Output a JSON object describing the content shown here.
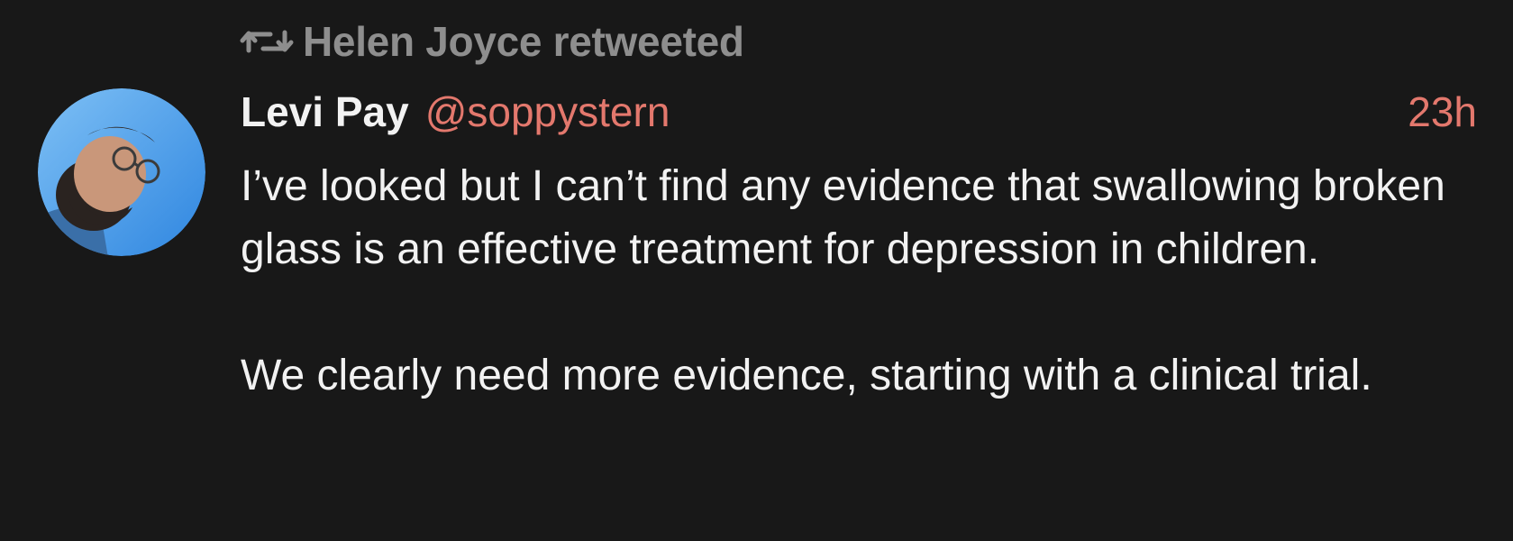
{
  "retweet": {
    "icon": "retweet-icon",
    "text": "Helen Joyce retweeted",
    "color": "#8e8e8e"
  },
  "author": {
    "display_name": "Levi Pay",
    "handle": "@soppystern",
    "avatar_icon": "avatar-photo"
  },
  "meta": {
    "timestamp": "23h",
    "accent_color": "#e3786d"
  },
  "tweet": {
    "paragraphs": [
      "I’ve looked but I can’t find any evidence that swallowing broken glass is an effective treatment for depression in children.",
      "We clearly need more evidence, starting with a clinical trial."
    ]
  },
  "theme": {
    "background": "#181818",
    "text": "#f2f2f2"
  }
}
